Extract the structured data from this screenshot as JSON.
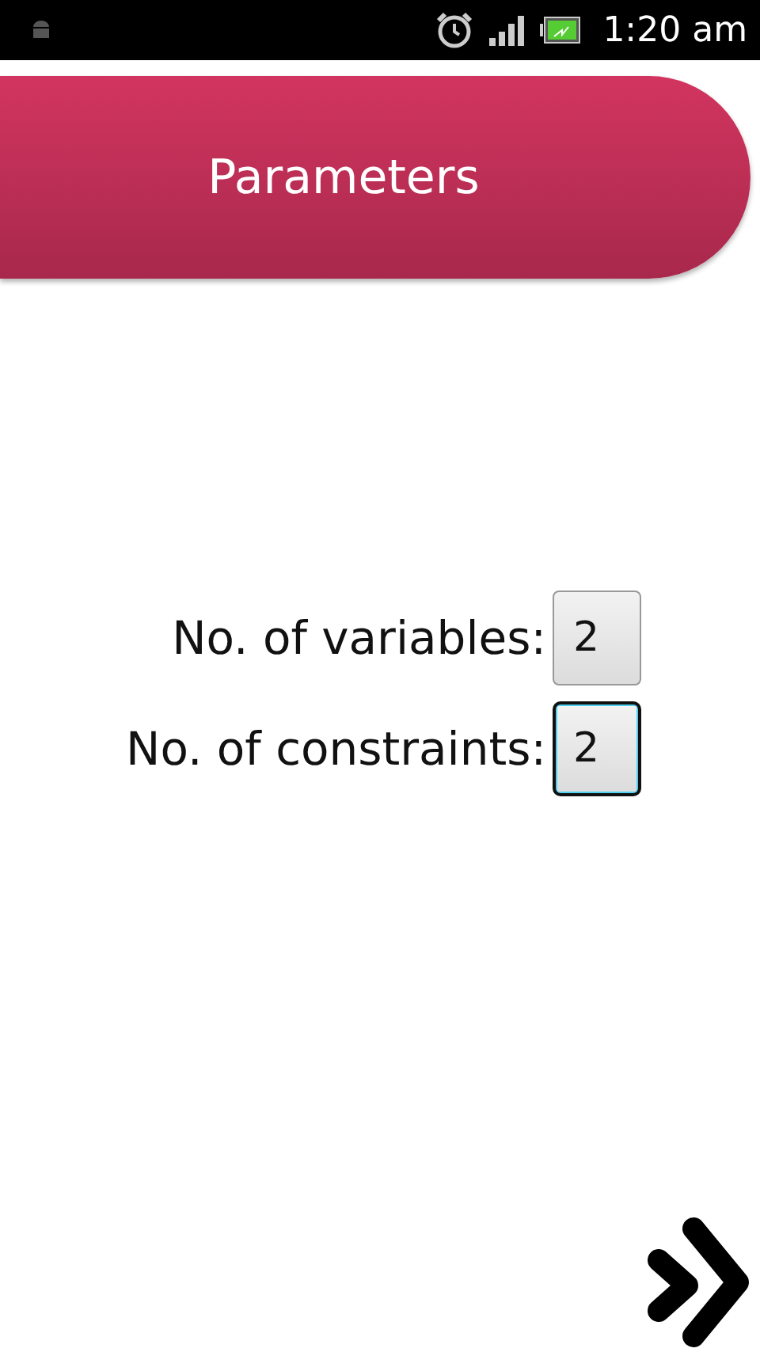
{
  "status_bar": {
    "time": "1:20 am"
  },
  "header": {
    "title": "Parameters"
  },
  "fields": [
    {
      "label": "No. of variables:",
      "value": "2",
      "focused": false
    },
    {
      "label": "No. of constraints:",
      "value": "2",
      "focused": true
    }
  ]
}
